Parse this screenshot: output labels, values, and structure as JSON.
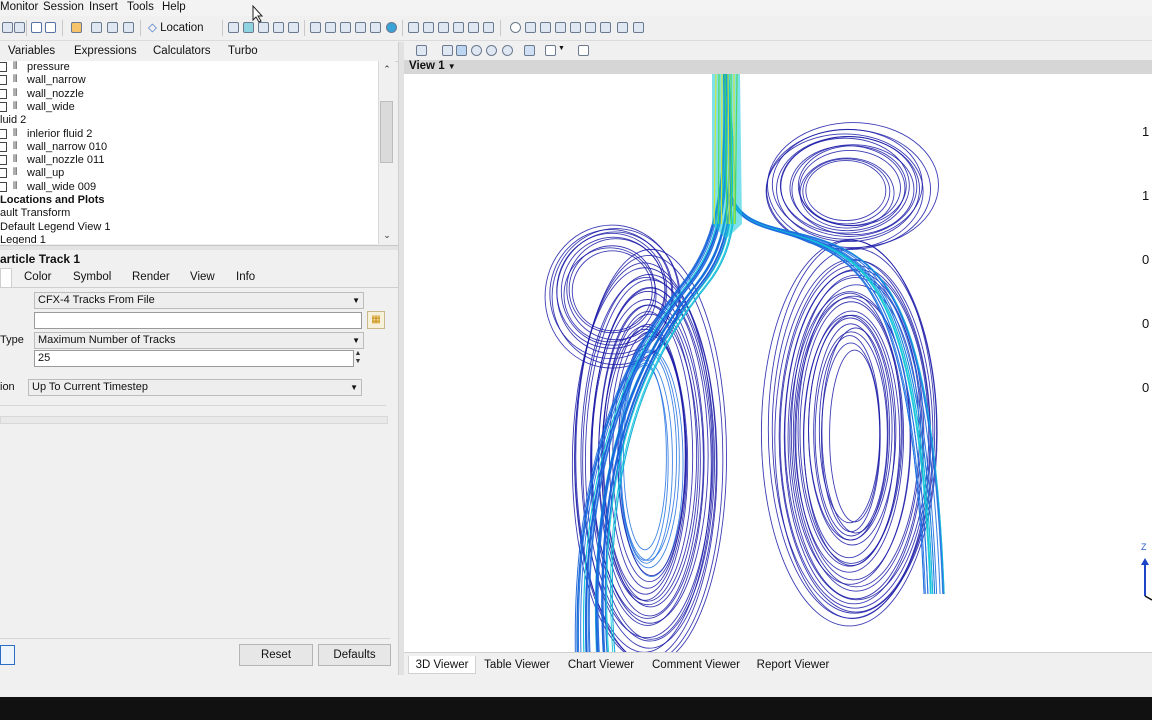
{
  "menubar": {
    "items": [
      "Monitor",
      "Session",
      "Insert",
      "Tools",
      "Help"
    ]
  },
  "toolbar": {
    "location_label": "Location"
  },
  "left_tabs": [
    "Variables",
    "Expressions",
    "Calculators",
    "Turbo"
  ],
  "tree": {
    "rows": [
      {
        "label": "pressure",
        "type": "child"
      },
      {
        "label": "wall_narrow",
        "type": "child"
      },
      {
        "label": "wall_nozzle",
        "type": "child"
      },
      {
        "label": "wall_wide",
        "type": "child"
      },
      {
        "label": "luid 2",
        "type": "group"
      },
      {
        "label": "inlerior fluid 2",
        "type": "child"
      },
      {
        "label": "wall_narrow 010",
        "type": "child"
      },
      {
        "label": "wall_nozzle 011",
        "type": "child"
      },
      {
        "label": "wall_up",
        "type": "child"
      },
      {
        "label": "wall_wide 009",
        "type": "child"
      },
      {
        "label": "Locations and Plots",
        "type": "section"
      },
      {
        "label": "ault Transform",
        "type": "plain"
      },
      {
        "label": "Default Legend View 1",
        "type": "plain"
      },
      {
        "label": "Legend 1",
        "type": "plain"
      }
    ]
  },
  "details": {
    "title": "article Track 1",
    "tabs": [
      "Color",
      "Symbol",
      "Render",
      "View",
      "Info"
    ],
    "source_value": "CFX-4 Tracks From File",
    "file_value": "",
    "type_label": "Type",
    "type_value": "Maximum Number of Tracks",
    "count_value": "25",
    "option_label": "ion",
    "option_value": "Up To Current Timestep",
    "reset_label": "Reset",
    "defaults_label": "Defaults"
  },
  "viewer": {
    "view_label": "View 1",
    "legend_values": [
      "1",
      "1",
      "0",
      "0",
      "0"
    ],
    "axis_label": "Z",
    "bottom_tabs": [
      "3D Viewer",
      "Table Viewer",
      "Chart Viewer",
      "Comment Viewer",
      "Report Viewer"
    ],
    "active_tab": "3D Viewer"
  },
  "colors": {
    "streamline_dark": "#1a1aa8",
    "streamline_mid": "#1f6fe0",
    "streamline_cyan": "#12c6d8",
    "streamline_green": "#4fdc4a",
    "streamline_yellow": "#d8e82a"
  }
}
